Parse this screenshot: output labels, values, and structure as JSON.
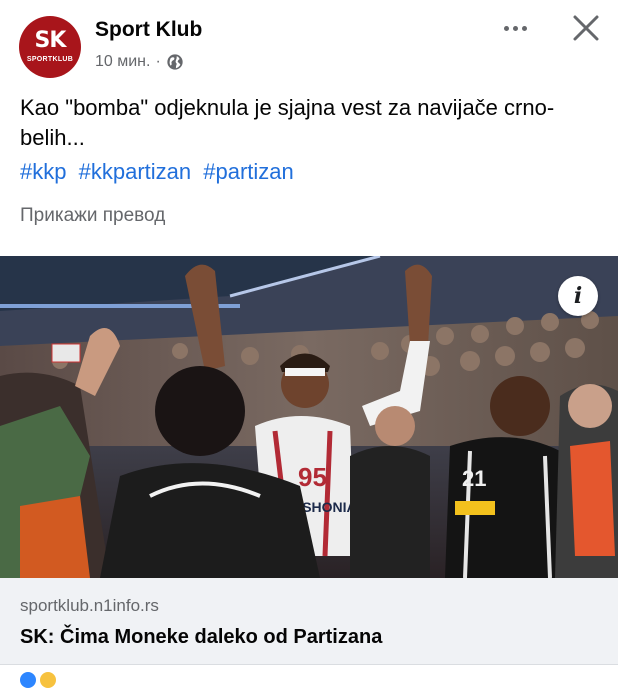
{
  "header": {
    "page_name": "Sport Klub",
    "avatar_text": "SK",
    "avatar_subtext": "SPORTKLUB",
    "timestamp": "10 мин.",
    "separator": "·",
    "privacy_icon": "globe-icon",
    "more_icon": "more-horizontal-icon",
    "close_icon": "close-icon"
  },
  "post": {
    "text": "Kao \"bomba\" odjeknula je sjajna vest za navijače crno-belih...",
    "hashtags": [
      "#kkp",
      "#kkpartizan",
      "#partizan"
    ],
    "translate_label": "Прикажи превод"
  },
  "photo": {
    "jersey_number": "95",
    "jersey_text": "BASHONIA",
    "info_icon": "info-icon",
    "info_label": "i"
  },
  "link_card": {
    "domain": "sportklub.n1info.rs",
    "title": "SK: Čima Moneke daleko od Partizana"
  },
  "colors": {
    "brand_red": "#a8151b",
    "hashtag_blue": "#216fdb",
    "secondary_text": "#65676b",
    "card_background": "#f0f2f5"
  }
}
